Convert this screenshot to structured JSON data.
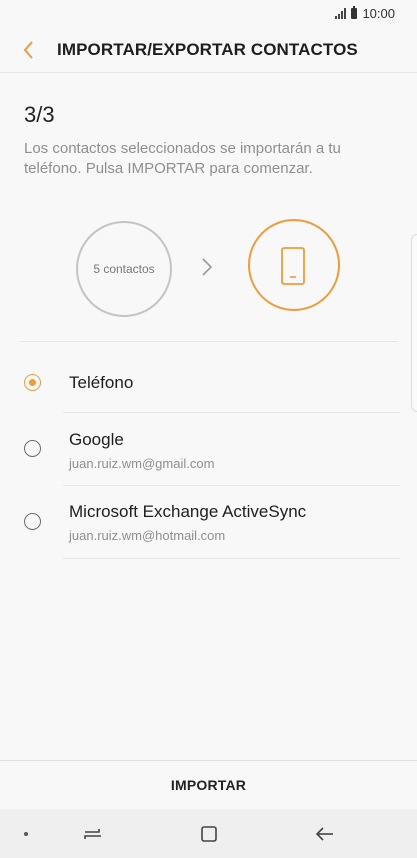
{
  "status_bar": {
    "time": "10:00",
    "icons": [
      "signal-icon",
      "battery-icon"
    ]
  },
  "header": {
    "title": "IMPORTAR/EXPORTAR CONTACTOS",
    "back_icon": "chevron-left-icon"
  },
  "step": "3/3",
  "description": "Los contactos seleccionados se importarán a tu teléfono. Pulsa IMPORTAR para comenzar.",
  "graphic": {
    "source_label": "5 contactos",
    "arrow_icon": "chevron-right-icon",
    "target_icon": "phone-icon"
  },
  "options": [
    {
      "title": "Teléfono",
      "subtitle": "",
      "selected": true
    },
    {
      "title": "Google",
      "subtitle": "juan.ruiz.wm@gmail.com",
      "selected": false
    },
    {
      "title": "Microsoft Exchange ActiveSync",
      "subtitle": "juan.ruiz.wm@hotmail.com",
      "selected": false
    }
  ],
  "import_button": "IMPORTAR",
  "nav": {
    "icons": [
      "recents-icon",
      "home-icon",
      "back-icon"
    ]
  },
  "colors": {
    "accent": "#f09a3e",
    "background": "#f8f8f8",
    "secondary_text": "#8f8f8f"
  }
}
